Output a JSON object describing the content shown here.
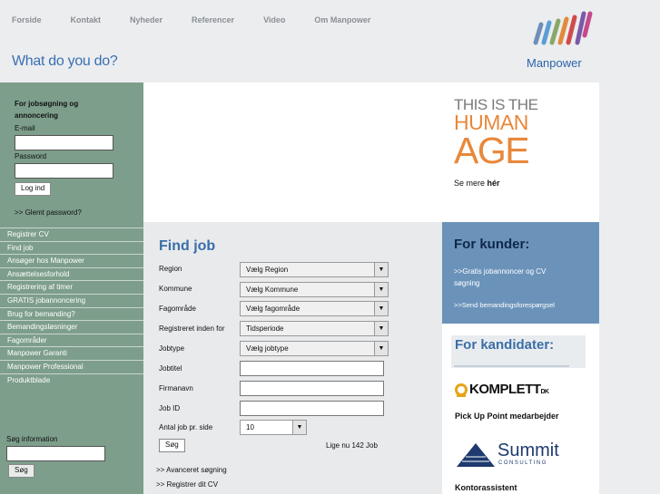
{
  "nav": [
    "Forside",
    "Kontakt",
    "Nyheder",
    "Referencer",
    "Video",
    "Om Manpower"
  ],
  "tagline": "What do you do?",
  "logo_text": "Manpower",
  "login": {
    "heading1": "For jobsøgning og",
    "heading2": "annoncering",
    "email_label": "E-mail",
    "password_label": "Password",
    "login_button": "Log ind",
    "forgot": ">> Glemt password?"
  },
  "side_menu": [
    "Registrer CV",
    "Find job",
    "Ansøger hos Manpower",
    "Ansættelsesforhold",
    "Registrering af timer",
    "GRATIS jobannoncering",
    "Brug for bemanding?",
    "Bemandingsløsninger",
    "Fagområder",
    "Manpower Garanti",
    "Manpower Professional",
    "Produktblade"
  ],
  "site_search": {
    "label": "Søg information",
    "button": "Søg"
  },
  "banner": {
    "line1": "THIS IS THE",
    "line2": "HUMAN",
    "line3": "AGE",
    "see_more_prefix": "Se mere ",
    "see_more_link": "hér"
  },
  "find_job": {
    "title": "Find job",
    "fields": [
      {
        "label": "Region",
        "value": "Vælg Region"
      },
      {
        "label": "Kommune",
        "value": "Vælg Kommune"
      },
      {
        "label": "Fagområde",
        "value": "Vælg fagområde"
      },
      {
        "label": "Registreret inden for",
        "value": "Tidsperiode"
      },
      {
        "label": "Jobtype",
        "value": "Vælg jobtype"
      }
    ],
    "text_fields": [
      "Jobtitel",
      "Firmanavn",
      "Job ID"
    ],
    "per_page_label": "Antal job pr. side",
    "per_page_value": "10",
    "search_button": "Søg",
    "count_text": "Lige nu 142 Job",
    "advanced": ">> Avanceret søgning",
    "register_cv": ">> Registrer dit CV"
  },
  "kunder": {
    "title": "For kunder:",
    "link1_line1": ">>Gratis jobannoncer og CV",
    "link1_line2": "søgning",
    "link2": ">>Send bemandingsforespørgsel"
  },
  "kandidater": {
    "title": "For kandidater:",
    "komplett": "KOMPLETT",
    "komplett_suffix": "DK",
    "caption1": "Pick Up Point medarbejder",
    "summit": "Summit",
    "summit_sub": "CONSULTING",
    "caption2": "Kontorassistent"
  }
}
